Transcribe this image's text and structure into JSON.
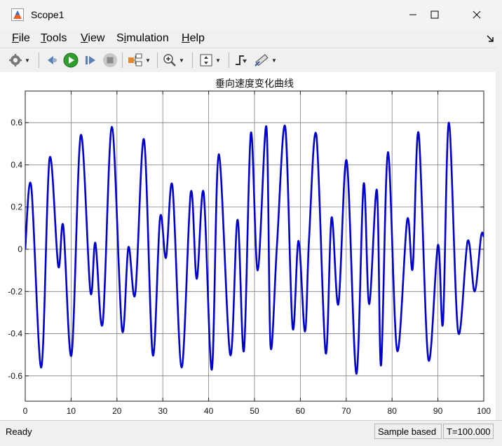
{
  "window": {
    "title": "Scope1"
  },
  "menu": [
    {
      "pre": "",
      "u": "F",
      "post": "ile"
    },
    {
      "pre": "",
      "u": "T",
      "post": "ools"
    },
    {
      "pre": "",
      "u": "V",
      "post": "iew"
    },
    {
      "pre": "S",
      "u": "i",
      "post": "mulation"
    },
    {
      "pre": "",
      "u": "H",
      "post": "elp"
    }
  ],
  "status": {
    "text": "Ready",
    "mode": "Sample based",
    "time": "T=100.000"
  },
  "colors": {
    "trace": "#0000cd",
    "grid": "#7f7f7f"
  },
  "chart_data": {
    "type": "line",
    "title": "垂向速度变化曲线",
    "xlabel": "",
    "ylabel": "",
    "xlim": [
      0,
      100
    ],
    "ylim": [
      -0.72,
      0.75
    ],
    "xticks": [
      0,
      10,
      20,
      30,
      40,
      50,
      60,
      70,
      80,
      90,
      100
    ],
    "yticks": [
      -0.6,
      -0.4,
      -0.2,
      0,
      0.2,
      0.4,
      0.6
    ],
    "ytick_labels": [
      "-0.6",
      "-0.4",
      "-0.2",
      "0",
      "0.2",
      "0.4",
      "0.6"
    ],
    "grid": true,
    "series": [
      {
        "x": [
          0,
          1.3,
          3.5,
          5.3,
          7.2,
          8.3,
          10.1,
          12.1,
          14.2,
          15.3,
          16.9,
          18.9,
          21.1,
          22.5,
          24.0,
          25.9,
          27.8,
          29.4,
          30.7,
          32.1,
          34.1,
          36.1,
          37.4,
          38.9,
          40.7,
          42.2,
          44.7,
          46.3,
          47.7,
          49.2,
          50.7,
          52.6,
          53.5,
          54.9,
          56.7,
          58.3,
          59.6,
          61.0,
          61.9,
          63.5,
          65.5,
          66.8,
          68.3,
          70.1,
          72.2,
          73.8,
          75.0,
          76.7,
          77.6,
          79.1,
          81.1,
          83.3,
          84.5,
          85.8,
          87.9,
          90.0,
          91.1,
          92.4,
          94.4,
          96.5,
          98.0,
          99.4,
          100
        ],
        "y": [
          0,
          0.3,
          -0.56,
          0.43,
          -0.08,
          0.11,
          -0.5,
          0.54,
          -0.2,
          0.03,
          -0.35,
          0.58,
          -0.38,
          0.01,
          -0.21,
          0.52,
          -0.5,
          0.15,
          -0.04,
          0.3,
          -0.56,
          0.27,
          -0.14,
          0.27,
          -0.57,
          0.45,
          -0.5,
          0.14,
          -0.48,
          0.55,
          -0.1,
          0.58,
          -0.46,
          0.02,
          0.58,
          -0.37,
          0.04,
          -0.39,
          0.05,
          0.54,
          -0.49,
          0.15,
          -0.26,
          0.42,
          -0.59,
          0.31,
          -0.26,
          0.28,
          -0.55,
          0.46,
          -0.48,
          0.14,
          -0.09,
          0.55,
          -0.52,
          0.02,
          -0.35,
          0.6,
          -0.39,
          0.04,
          -0.2,
          0.06,
          0.06
        ]
      }
    ]
  }
}
